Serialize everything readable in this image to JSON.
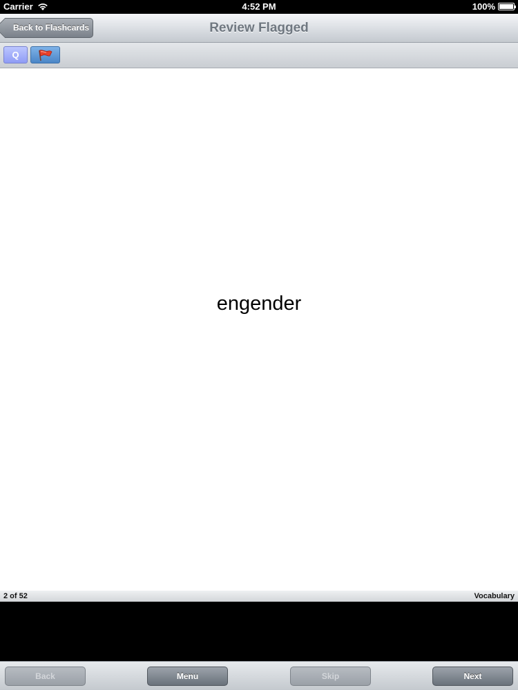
{
  "status": {
    "carrier": "Carrier",
    "time": "4:52 PM",
    "battery": "100%",
    "battery_level": 1.0
  },
  "nav": {
    "back_label": "Back to Flashcards",
    "title": "Review Flagged"
  },
  "toolbar": {
    "q_label": "Q",
    "flag_icon": "flag-icon"
  },
  "card": {
    "word": "engender"
  },
  "info": {
    "progress": "2 of 52",
    "category": "Vocabulary"
  },
  "bottom": {
    "back_label": "Back",
    "menu_label": "Menu",
    "skip_label": "Skip",
    "next_label": "Next"
  },
  "colors": {
    "q_accent": "#8f9cf5",
    "flag_button": "#4b86c7",
    "flag": "#e8402a"
  }
}
